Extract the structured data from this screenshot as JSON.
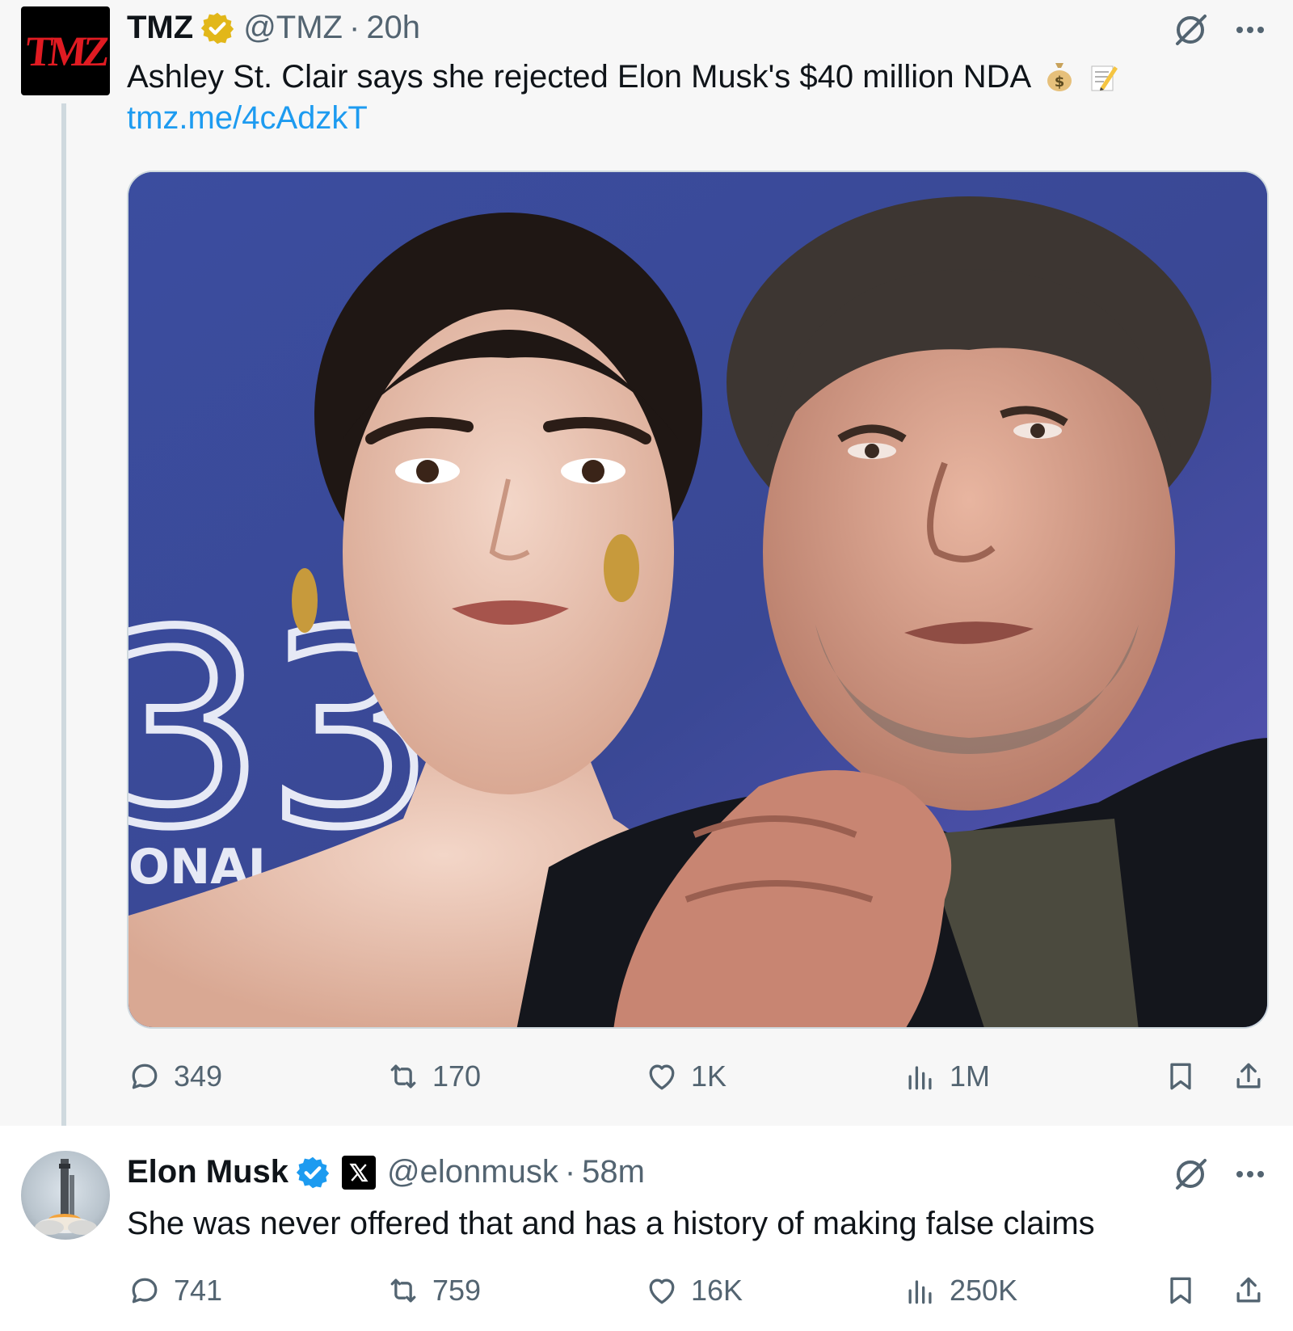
{
  "tweet1": {
    "author": {
      "name": "TMZ",
      "handle": "@TMZ",
      "time": "20h",
      "avatar_logo": "TMZ",
      "badge": "gold-verified-badge-icon"
    },
    "text": "Ashley St. Clair says she rejected Elon Musk's $40 million NDA",
    "emojis": [
      "money-bag-emoji",
      "memo-emoji"
    ],
    "link": "tmz.me/4cAdzkT",
    "media": {
      "backdrop_text": "33",
      "backdrop_text_small": "ONAL"
    },
    "actions": {
      "replies": "349",
      "reposts": "170",
      "likes": "1K",
      "views": "1M"
    }
  },
  "tweet2": {
    "author": {
      "name": "Elon Musk",
      "handle": "@elonmusk",
      "time": "58m",
      "badge": "blue-verified-badge-icon",
      "affiliation": "x-logo-icon"
    },
    "text": "She was never offered that and has a history of making false claims",
    "actions": {
      "replies": "741",
      "reposts": "759",
      "likes": "16K",
      "views": "250K"
    }
  },
  "colors": {
    "link": "#1d9bf0",
    "secondary_text": "#536471",
    "verified_blue": "#1d9bf0",
    "verified_gold": "#e2b719",
    "tmz_red": "#e01b22"
  }
}
